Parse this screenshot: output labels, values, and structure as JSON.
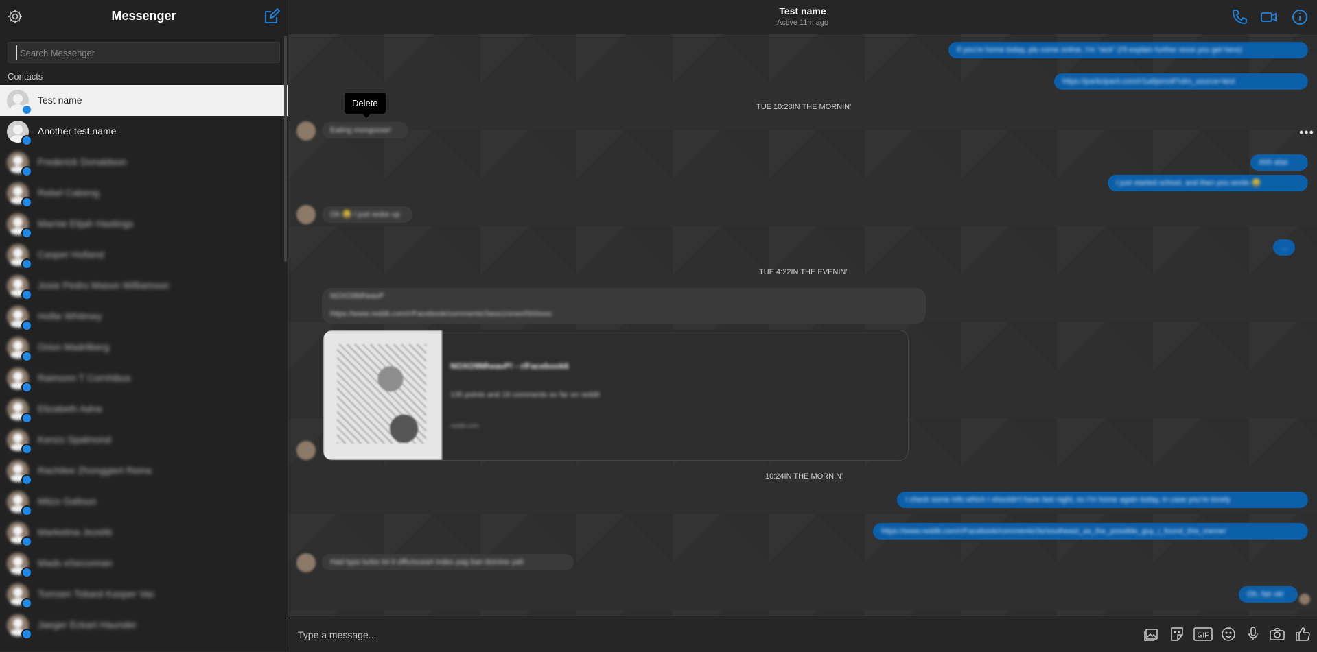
{
  "sidebar": {
    "title": "Messenger",
    "search_placeholder": "Search Messenger",
    "contacts_label": "Contacts",
    "contacts": [
      {
        "name": "Test name"
      },
      {
        "name": "Another test name"
      },
      {
        "name": "Frederick Donaldson"
      },
      {
        "name": "Rebel Cabeng"
      },
      {
        "name": "Marnie Elijah Hastings"
      },
      {
        "name": "Casper Holland"
      },
      {
        "name": "Josie Pedro Mason Williamson"
      },
      {
        "name": "Hollie Whitmey"
      },
      {
        "name": "Orion Madrilberg"
      },
      {
        "name": "Raimonn T Cornhibus"
      },
      {
        "name": "Elizabeth Adna"
      },
      {
        "name": "Kenzo Spalmond"
      },
      {
        "name": "Rachilee Zhonggiert Reina"
      },
      {
        "name": "Mitzo Galloun"
      },
      {
        "name": "Marketina Jezeliti"
      },
      {
        "name": "Mads eSeconnan"
      },
      {
        "name": "Tomsen Tobard Kasper Vac"
      },
      {
        "name": "Jaeger Eckart Haunder"
      }
    ]
  },
  "chat": {
    "title": "Test name",
    "status": "Active 11m ago",
    "timestamps": [
      "TUE 10:28IN THE MORNIN'",
      "TUE 4:22IN THE EVENIN'",
      "10:24IN THE MORNIN'"
    ],
    "tooltip": "Delete",
    "more_label": "•••",
    "messages": [
      {
        "text": "If you're home today, pls come online, I'm \"sick\" (I'll explain further once you get here)"
      },
      {
        "text": "https://participant.com/r/1a6jsmoll?utm_source=text"
      },
      {
        "text": "Eating mongoose!"
      },
      {
        "text": "Ahh alas"
      },
      {
        "text": "I just started school, and then you wrote 😂"
      },
      {
        "text": "Oh 😂 I just woke up"
      },
      {
        "text": "..."
      },
      {
        "text": "NOXO9MheavP"
      },
      {
        "text": "https://www.reddit.com/r/Facebook/comments/3ase1/oneof300ooo"
      },
      {
        "text": "I check some info which I shouldn't have last night, so I'm home again today, in case you're lonely"
      },
      {
        "text": "https://www.reddit.com/r/Facebook/comments/3s/southeast_as_the_possible_guy_i_found_this_meme/"
      },
      {
        "text": "Had typo turbo lol it officiousart index pag ban itomine yah"
      },
      {
        "text": "Oh, fair ok!"
      }
    ],
    "link_card": {
      "title": "NOXO9MheavP! - r/Facebook6",
      "description": "135 points and 19 comments so far on reddit",
      "domain": "reddit.com"
    }
  },
  "composer": {
    "placeholder": "Type a message...",
    "gif_label": "GIF"
  },
  "colors": {
    "accent": "#1e88e5",
    "outgoing_bubble": "#0b5ea8",
    "background": "#2b2b2b"
  }
}
